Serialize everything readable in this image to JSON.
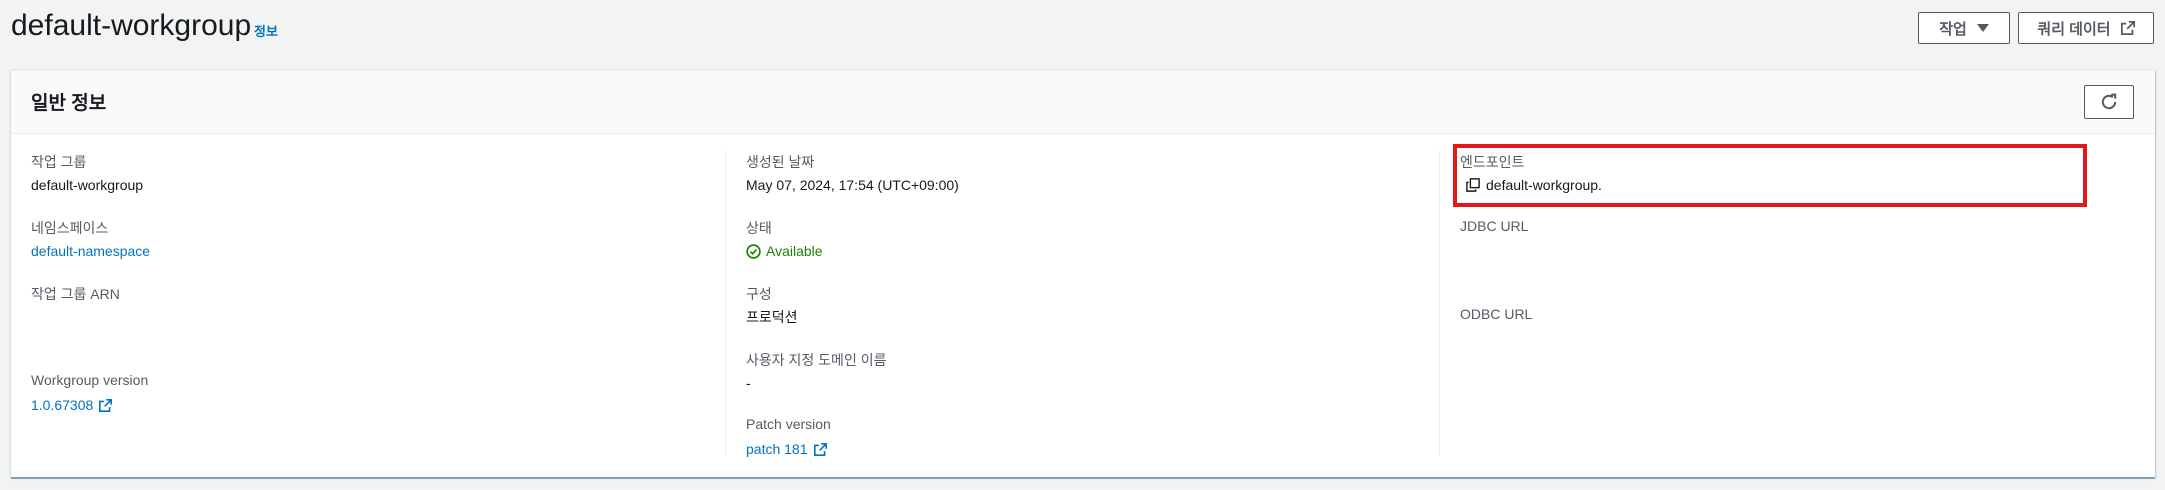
{
  "header": {
    "title": "default-workgroup",
    "info_link": "정보",
    "actions_button": "작업",
    "query_button": "쿼리 데이터"
  },
  "panel": {
    "title": "일반 정보"
  },
  "col1": {
    "workgroup_label": "작업 그룹",
    "workgroup_value": "default-workgroup",
    "namespace_label": "네임스페이스",
    "namespace_value": "default-namespace",
    "arn_label": "작업 그룹 ARN",
    "version_label": "Workgroup version",
    "version_value": "1.0.67308"
  },
  "col2": {
    "created_label": "생성된 날짜",
    "created_value": "May 07, 2024, 17:54 (UTC+09:00)",
    "status_label": "상태",
    "status_value": "Available",
    "config_label": "구성",
    "config_value": "프로덕션",
    "domain_label": "사용자 지정 도메인 이름",
    "domain_value": "-",
    "patch_label": "Patch version",
    "patch_value": "patch 181"
  },
  "col3": {
    "endpoint_label": "엔드포인트",
    "endpoint_value": "default-workgroup.",
    "jdbc_label": "JDBC URL",
    "odbc_label": "ODBC URL"
  },
  "colors": {
    "link": "#0073bb",
    "success": "#1d8102",
    "highlight": "#e3181b"
  }
}
